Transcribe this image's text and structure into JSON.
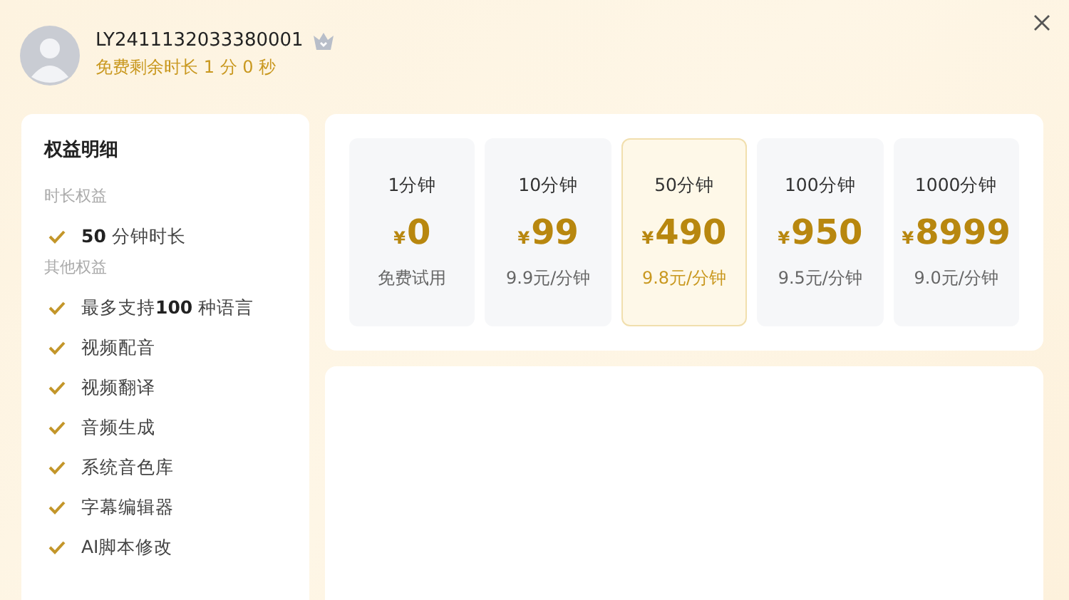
{
  "user": {
    "id": "LY2411132033380001",
    "remaining": "免费剩余时长 1 分 0 秒"
  },
  "benefits": {
    "title": "权益明细",
    "groups": [
      {
        "label": "时长权益",
        "items": [
          {
            "text": "**50** 分钟时长"
          }
        ]
      },
      {
        "label": "其他权益",
        "items": [
          {
            "text": "最多支持**100** 种语言"
          },
          {
            "text": "视频配音"
          },
          {
            "text": "视频翻译"
          },
          {
            "text": "音频生成"
          },
          {
            "text": "系统音色库"
          },
          {
            "text": "字幕编辑器"
          },
          {
            "text": "AI脚本修改"
          }
        ]
      }
    ]
  },
  "plans": [
    {
      "duration": "1分钟",
      "currency": "¥",
      "price": "0",
      "note": "免费试用",
      "selected": false
    },
    {
      "duration": "10分钟",
      "currency": "¥",
      "price": "99",
      "note": "9.9元/分钟",
      "selected": false
    },
    {
      "duration": "50分钟",
      "currency": "¥",
      "price": "490",
      "note": "9.8元/分钟",
      "selected": true
    },
    {
      "duration": "100分钟",
      "currency": "¥",
      "price": "950",
      "note": "9.5元/分钟",
      "selected": false
    },
    {
      "duration": "1000分钟",
      "currency": "¥",
      "price": "8999",
      "note": "9.0元/分钟",
      "selected": false
    }
  ]
}
